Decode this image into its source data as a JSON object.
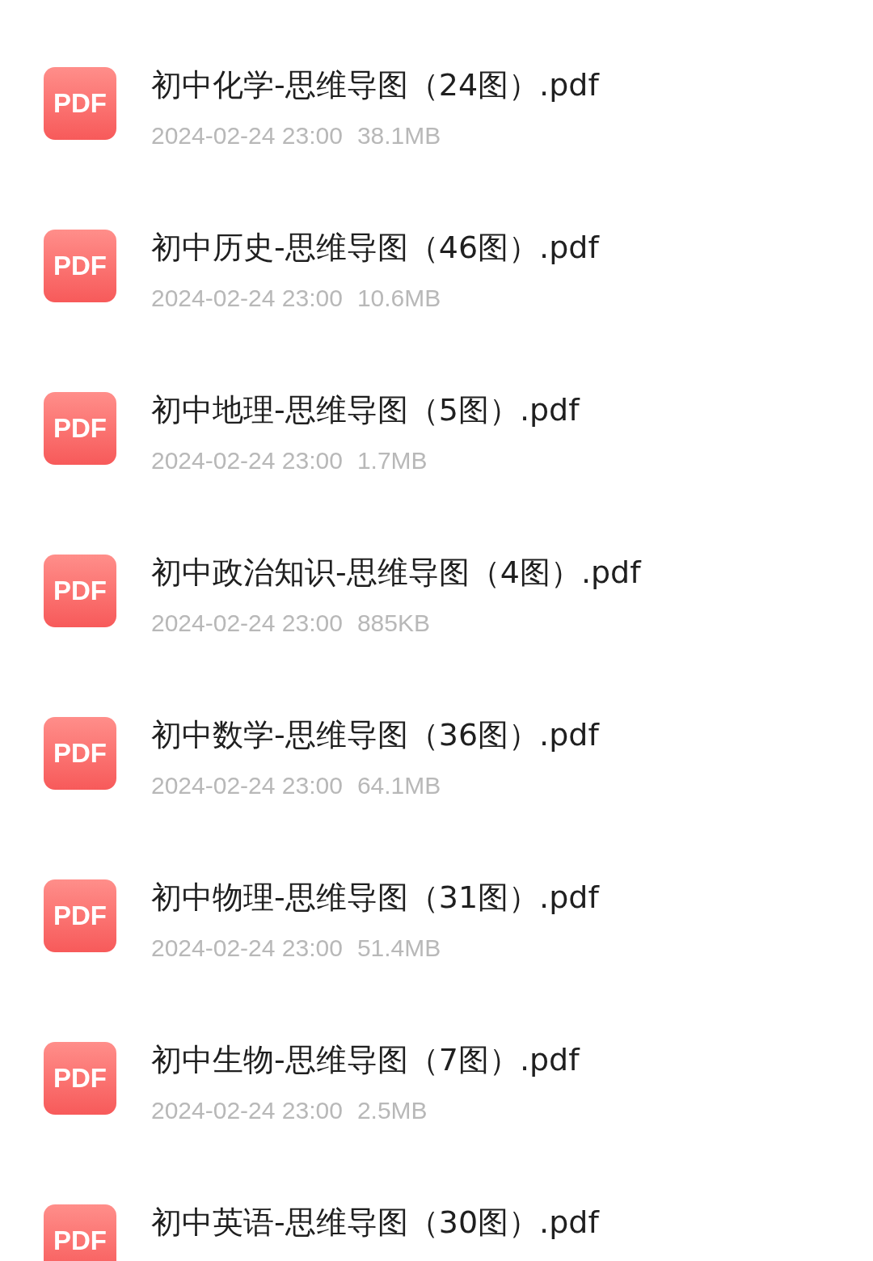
{
  "files": [
    {
      "badge": "PDF",
      "name": "初中化学-思维导图（24图）.pdf",
      "date": "2024-02-24 23:00",
      "size": "38.1MB"
    },
    {
      "badge": "PDF",
      "name": "初中历史-思维导图（46图）.pdf",
      "date": "2024-02-24 23:00",
      "size": "10.6MB"
    },
    {
      "badge": "PDF",
      "name": "初中地理-思维导图（5图）.pdf",
      "date": "2024-02-24 23:00",
      "size": "1.7MB"
    },
    {
      "badge": "PDF",
      "name": "初中政治知识-思维导图（4图）.pdf",
      "date": "2024-02-24 23:00",
      "size": "885KB"
    },
    {
      "badge": "PDF",
      "name": "初中数学-思维导图（36图）.pdf",
      "date": "2024-02-24 23:00",
      "size": "64.1MB"
    },
    {
      "badge": "PDF",
      "name": "初中物理-思维导图（31图）.pdf",
      "date": "2024-02-24 23:00",
      "size": "51.4MB"
    },
    {
      "badge": "PDF",
      "name": "初中生物-思维导图（7图）.pdf",
      "date": "2024-02-24 23:00",
      "size": "2.5MB"
    },
    {
      "badge": "PDF",
      "name": "初中英语-思维导图（30图）.pdf"
    }
  ]
}
